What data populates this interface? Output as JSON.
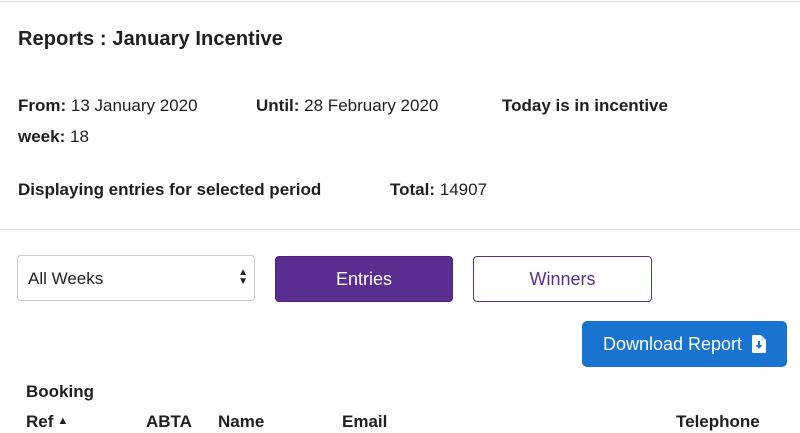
{
  "header": {
    "title": "Reports : January Incentive"
  },
  "period": {
    "from_label": "From:",
    "from_value": "13 January 2020",
    "until_label": "Until:",
    "until_value": "28 February 2020",
    "today_text": "Today is in incentive",
    "week_label": "week:",
    "week_value": "18",
    "displaying_text": "Displaying entries for selected period",
    "total_label": "Total:",
    "total_value": "14907"
  },
  "controls": {
    "week_select": {
      "selected": "All Weeks"
    },
    "entries_button": "Entries",
    "winners_button": "Winners",
    "download_button": "Download Report"
  },
  "table": {
    "columns": [
      "Booking Ref",
      "ABTA",
      "Name",
      "Email",
      "Telephone"
    ],
    "booking_line1": "Booking",
    "booking_line2": "Ref",
    "abta": "ABTA",
    "name": "Name",
    "email": "Email",
    "telephone": "Telephone",
    "sort_column": "Booking Ref",
    "sort_direction": "ascending"
  },
  "colors": {
    "primary_purple": "#5a2d91",
    "download_blue": "#1973d1",
    "divider": "#dcdcdc"
  },
  "icons": {
    "download": "file-download-icon",
    "sort": "sort-ascending-icon",
    "select": "select-arrows-icon"
  }
}
